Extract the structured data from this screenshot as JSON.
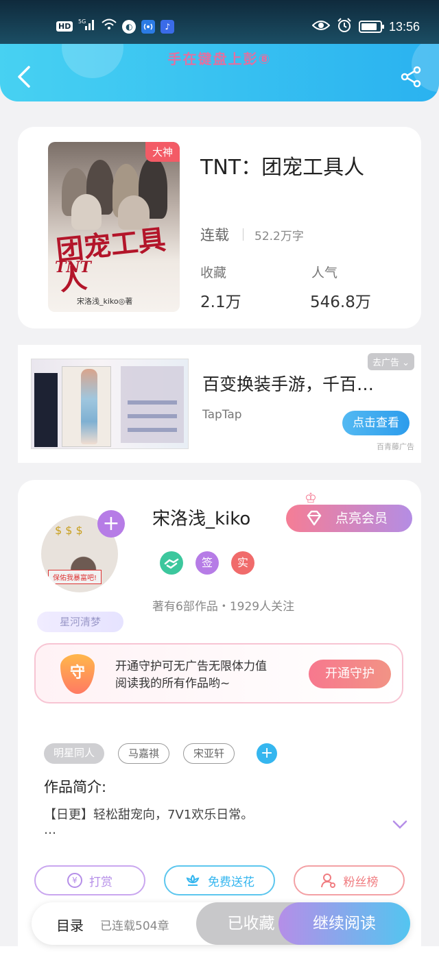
{
  "status_bar": {
    "hd": "HD",
    "network": "5G",
    "time": "13:56",
    "battery_level": 0.85
  },
  "header": {
    "title": "手在键盘上彭⑧"
  },
  "book": {
    "badge": "大神",
    "cover_title": "团宠工具人",
    "cover_tnt": "TNT",
    "cover_author": "宋洛浅_kiko◎著",
    "title": "TNT：团宠工具人",
    "status": "连载",
    "word_count": "52.2万字",
    "collect_label": "收藏",
    "collect_value": "2.1万",
    "popularity_label": "人气",
    "popularity_value": "546.8万"
  },
  "ad": {
    "title": "百变换装手游，千百…",
    "brand": "TapTap",
    "tag": "去广告",
    "button": "点击查看",
    "source": "百青藤广告"
  },
  "author": {
    "name": "宋洛浅_kiko",
    "vip_button": "点亮会员",
    "fan_tag": "星河清梦",
    "avatar_banner": "保佑我暴富吧!",
    "badges": [
      {
        "text": "",
        "color": "#3cc79d"
      },
      {
        "text": "签",
        "color": "#b67ce6"
      },
      {
        "text": "实",
        "color": "#f06b6b"
      }
    ],
    "meta": "著有6部作品・1929人关注"
  },
  "guard": {
    "shield": "守",
    "line1": "开通守护可无广告无限体力值",
    "line2": "阅读我的所有作品哟~",
    "button": "开通守护"
  },
  "tags": [
    "明星同人",
    "马嘉祺",
    "宋亚轩"
  ],
  "intro": {
    "label": "作品简介:",
    "line1": "【日更】轻松甜宠向，7V1欢乐日常。",
    "line2": "…"
  },
  "actions": {
    "reward": "打赏",
    "reward_icon": "¥",
    "flowers": "免费送花",
    "fans": "粉丝榜"
  },
  "bottom": {
    "toc": "目录",
    "chapters": "已连载504章",
    "collected": "已收藏",
    "continue": "继续阅读"
  }
}
